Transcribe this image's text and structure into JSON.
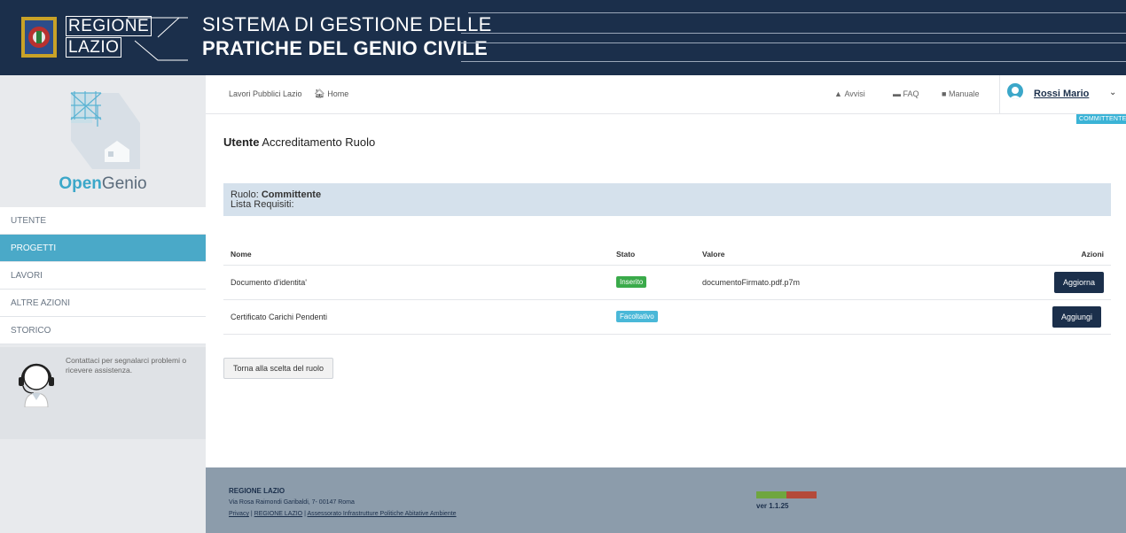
{
  "header": {
    "brand_line1": "REGIONE",
    "brand_line2": "LAZIO",
    "system_title_line1": "SISTEMA DI GESTIONE DELLE",
    "system_title_line2": "PRATICHE DEL GENIO CIVILE",
    "bg_color": "#1b2f4b"
  },
  "sidebar": {
    "logo_name_bold": "Open",
    "logo_name_rest": "Genio",
    "items": [
      {
        "label": "UTENTE",
        "active": false
      },
      {
        "label": "PROGETTI",
        "active": true
      },
      {
        "label": "LAVORI",
        "active": false
      },
      {
        "label": "ALTRE AZIONI",
        "active": false
      },
      {
        "label": "STORICO",
        "active": false
      }
    ],
    "help_text": "Contattaci per segnalarci problemi o ricevere assistenza.",
    "active_color": "#4aa9c8"
  },
  "topbar": {
    "breadcrumb_root": "Lavori Pubblici Lazio",
    "breadcrumb_home": "Home",
    "avvisi": "Avvisi",
    "faq": "FAQ",
    "manuale": "Manuale",
    "user_name": "Rossi Mario",
    "role_badge": "COMMITTENTE"
  },
  "main": {
    "title_bold": "Utente",
    "title_rest": "Accreditamento Ruolo",
    "role_label": "Ruolo:",
    "role_value": "Committente",
    "requirements_label": "Lista Requisiti:",
    "table": {
      "headers": [
        "Nome",
        "Stato",
        "Valore",
        "Azioni"
      ],
      "rows": [
        {
          "nome": "Documento d'identita'",
          "stato": "Inserito",
          "stato_color": "#3aaa4a",
          "valore": "documentoFirmato.pdf.p7m",
          "azione": "Aggiorna"
        },
        {
          "nome": "Certificato Carichi Pendenti",
          "stato": "Facoltativo",
          "stato_color": "#4ab8d8",
          "valore": "",
          "azione": "Aggiungi"
        }
      ]
    },
    "back_button": "Torna alla scelta del ruolo"
  },
  "footer": {
    "title": "REGIONE LAZIO",
    "address": "Via Rosa Raimondi Garibaldi, 7- 00147 Roma",
    "link_privacy": "Privacy",
    "link_regione": "REGIONE LAZIO",
    "link_assessorato": "Assessorato Infrastrutture Politiche Abitative Ambiente",
    "version": "ver 1.1.25",
    "bg_color": "#8c9cab"
  }
}
